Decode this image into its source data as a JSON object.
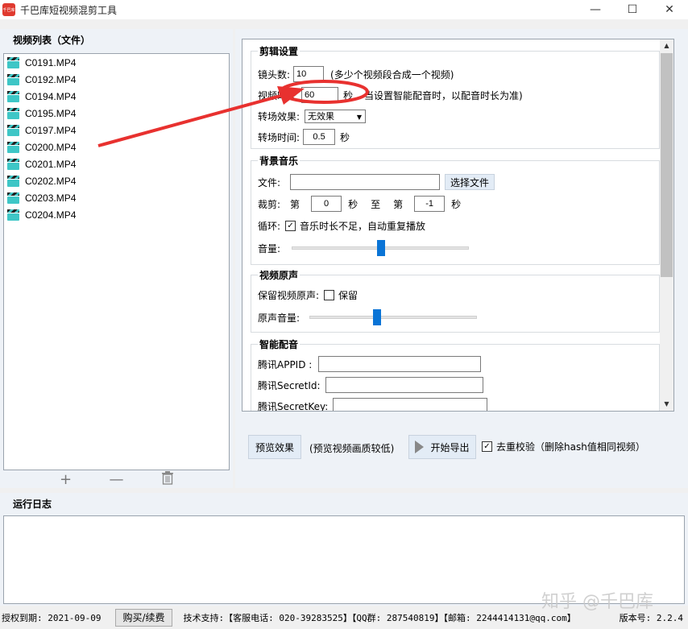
{
  "window": {
    "logo_text": "千巴库",
    "title": "千巴库短视频混剪工具",
    "minimize": "—",
    "maximize": "☐",
    "close": "✕"
  },
  "video_list": {
    "header": "视频列表（文件）",
    "files": [
      "C0191.MP4",
      "C0192.MP4",
      "C0194.MP4",
      "C0195.MP4",
      "C0197.MP4",
      "C0200.MP4",
      "C0201.MP4",
      "C0202.MP4",
      "C0203.MP4",
      "C0204.MP4"
    ],
    "tools": {
      "add": "+",
      "remove": "—",
      "delete": "🗑"
    }
  },
  "edit_settings": {
    "title": "剪辑设置",
    "clips_label": "镜头数:",
    "clips_value": "10",
    "clips_hint": "(多少个视频段合成一个视频)",
    "duration_label": "视频时长",
    "duration_value": "60",
    "duration_unit": "秒",
    "duration_hint": "当设置智能配音时，以配音时长为准)",
    "transition_label": "转场效果:",
    "transition_value": "无效果",
    "transition_time_label": "转场时间:",
    "transition_time_value": "0.5",
    "transition_time_unit": "秒"
  },
  "bgm": {
    "title": "背景音乐",
    "file_label": "文件:",
    "file_value": "",
    "choose_button": "选择文件",
    "trim_label": "裁剪:",
    "trim_from": "第",
    "trim_start": "0",
    "trim_unit1": "秒",
    "trim_to": "至",
    "trim_from2": "第",
    "trim_end": "-1",
    "trim_unit2": "秒",
    "loop_label": "循环:",
    "loop_text": "音乐时长不足，自动重复播放",
    "loop_checked": true,
    "volume_label": "音量:",
    "volume_level": 0.5
  },
  "original_audio": {
    "title": "视频原声",
    "keep_label": "保留视频原声:",
    "keep_text": "保留",
    "keep_checked": false,
    "volume_label": "原声音量:",
    "volume_level": 0.4
  },
  "smart_voice": {
    "title": "智能配音",
    "appid_label": "腾讯APPID :",
    "secretid_label": "腾讯SecretId:",
    "secretkey_label": "腾讯SecretKey:"
  },
  "actions": {
    "preview_button": "预览效果",
    "preview_hint": "(预览视频画质较低)",
    "export_button": "开始导出",
    "dedup_text": "去重校验（删除hash值相同视频）",
    "dedup_checked": true
  },
  "log": {
    "header": "运行日志"
  },
  "status": {
    "license": "授权到期: 2021-09-09",
    "buy_button": "购买/续费",
    "support": "技术支持:【客服电话: 020-39283525】【QQ群: 287540819】【邮箱: 2244414131@qq.com】",
    "version": "版本号: 2.2.4"
  },
  "watermark": "知乎 @千巴库",
  "colors": {
    "accent": "#0a74d6",
    "annotation": "#e8312f",
    "logo": "#e03a2f"
  }
}
